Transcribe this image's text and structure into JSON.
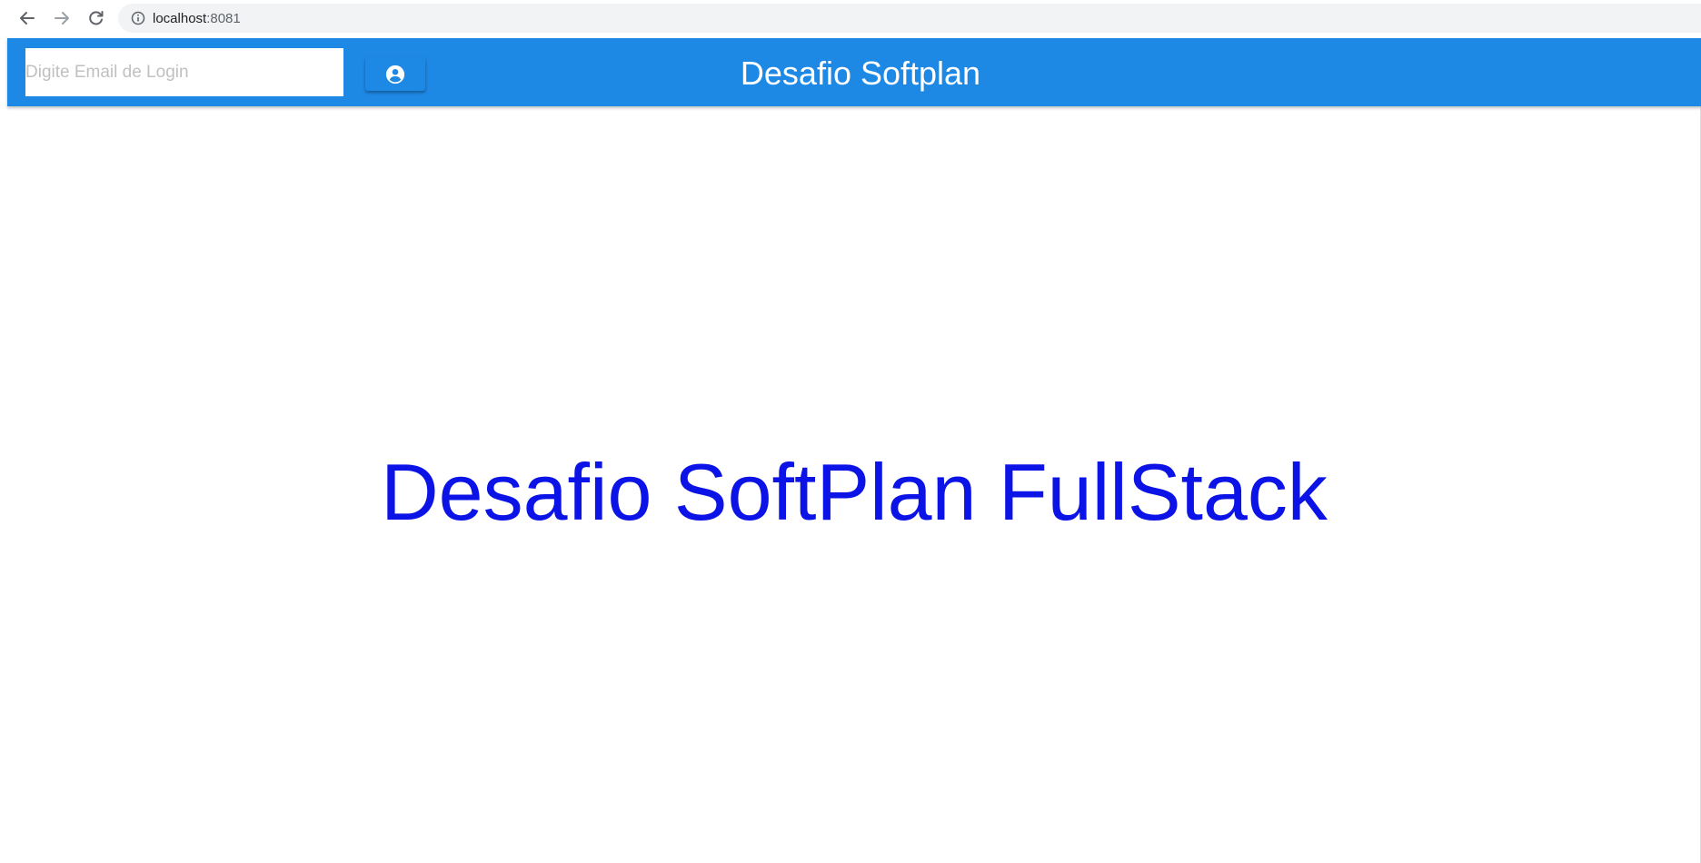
{
  "browser": {
    "url_host": "localhost",
    "url_port": ":8081",
    "icons": {
      "back": "arrow-left-icon",
      "forward": "arrow-right-icon",
      "reload": "reload-icon",
      "info": "info-icon"
    }
  },
  "header": {
    "login_placeholder": "Digite Email de Login",
    "login_value": "",
    "login_button_icon": "account-circle-icon",
    "title": "Desafio Softplan",
    "color": "#1e88e5"
  },
  "main": {
    "heading": "Desafio SoftPlan FullStack",
    "heading_color": "#0b13e6"
  }
}
